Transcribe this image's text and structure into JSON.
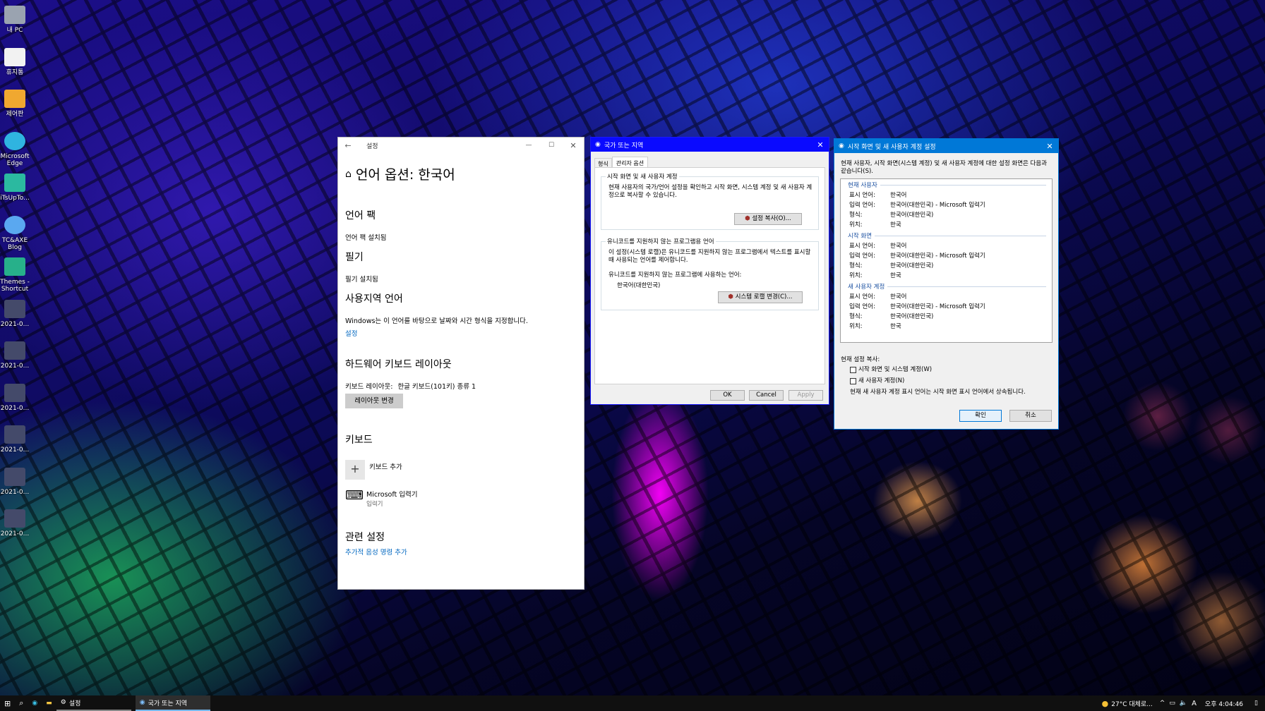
{
  "desktop": {
    "icons": [
      {
        "label": "내 PC",
        "icon": "computer-icon"
      },
      {
        "label": "휴지통",
        "icon": "recycle-bin-icon"
      },
      {
        "label": "제어판",
        "icon": "control-panel-icon"
      },
      {
        "label": "Microsoft Edge",
        "icon": "edge-icon"
      },
      {
        "label": "iTsUpTo...",
        "icon": "app-icon"
      },
      {
        "label": "TC&AXE Blog",
        "icon": "cloud-icon"
      },
      {
        "label": "Themes - Shortcut",
        "icon": "themes-icon"
      },
      {
        "label": "2021-0...",
        "icon": "image-file-icon"
      },
      {
        "label": "2021-0...",
        "icon": "image-file-icon"
      },
      {
        "label": "2021-0...",
        "icon": "image-file-icon"
      },
      {
        "label": "2021-0...",
        "icon": "image-file-icon"
      },
      {
        "label": "2021-0...",
        "icon": "image-file-icon"
      },
      {
        "label": "2021-0...",
        "icon": "image-file-icon"
      }
    ]
  },
  "settings": {
    "title": "설정",
    "page_title": "언어 옵션: 한국어",
    "lang_pack_heading": "언어 팩",
    "lang_pack_status": "언어 팩 설치됨",
    "handwriting_heading": "필기",
    "handwriting_status": "필기 설치됨",
    "regional_heading": "사용지역 언어",
    "regional_desc": "Windows는 이 언어를 바탕으로 날짜와 시간 형식을 지정합니다.",
    "regional_link": "설정",
    "hw_kb_heading": "하드웨어 키보드 레이아웃",
    "hw_kb_label": "키보드 레이아웃:",
    "hw_kb_value": "한글 키보드(101키) 종류 1",
    "hw_kb_button": "레이아웃 변경",
    "keyboards_heading": "키보드",
    "add_keyboard": "키보드 추가",
    "ime_name": "Microsoft 입력기",
    "ime_sub": "입력기",
    "related_heading": "관련 설정",
    "related_link": "추가적 음성 명령 추가"
  },
  "region": {
    "title": "국가 또는 지역",
    "tabs": [
      "형식",
      "관리자 옵션"
    ],
    "group1_title": "시작 화면 및 새 사용자 계정",
    "group1_desc": "현재 사용자의 국가/언어 설정을 확인하고 시작 화면, 시스템 계정 및 새 사용자 계정으로 복사할 수 있습니다.",
    "copy_button": "설정 복사(O)...",
    "group2_title": "유니코드를 지원하지 않는 프로그램용 언어",
    "group2_desc": "이 설정(시스템 로캘)은 유니코드를 지원하지 않는 프로그램에서 텍스트를 표시할 때 사용되는 언어를 제어합니다.",
    "current_label": "유니코드를 지원하지 않는 프로그램에 사용하는 언어:",
    "current_value": "한국어(대한민국)",
    "change_locale_button": "시스템 로캘 변경(C)...",
    "ok": "OK",
    "cancel": "Cancel",
    "apply": "Apply"
  },
  "copy_dialog": {
    "title": "시작 화면 및 새 사용자 계정 설정",
    "intro": "현재 사용자, 시작 화면(시스템 계정) 및 새 사용자 계정에 대한 설정 화면은 다음과 같습니다(S).",
    "sections": [
      {
        "name": "현재 사용자",
        "rows": [
          [
            "표시 언어:",
            "한국어"
          ],
          [
            "입력 언어:",
            "한국어(대한민국) - Microsoft 입력기"
          ],
          [
            "형식:",
            "한국어(대한민국)"
          ],
          [
            "위치:",
            "한국"
          ]
        ]
      },
      {
        "name": "시작 화면",
        "rows": [
          [
            "표시 언어:",
            "한국어"
          ],
          [
            "입력 언어:",
            "한국어(대한민국) - Microsoft 입력기"
          ],
          [
            "형식:",
            "한국어(대한민국)"
          ],
          [
            "위치:",
            "한국"
          ]
        ]
      },
      {
        "name": "새 사용자 계정",
        "rows": [
          [
            "표시 언어:",
            "한국어"
          ],
          [
            "입력 언어:",
            "한국어(대한민국) - Microsoft 입력기"
          ],
          [
            "형식:",
            "한국어(대한민국)"
          ],
          [
            "위치:",
            "한국"
          ]
        ]
      }
    ],
    "copy_label": "현재 설정 복사:",
    "check1": "시작 화면 및 시스템 계정(W)",
    "check2": "새 사용자 계정(N)",
    "note": "현재 새 사용자 계정 표시 언어는 시작 화면 표시 언어에서 상속됩니다.",
    "ok": "확인",
    "cancel": "취소"
  },
  "taskbar": {
    "apps": [
      {
        "label": "설정",
        "icon": "gear-icon"
      },
      {
        "label": "국가 또는 지역",
        "icon": "globe-icon"
      }
    ],
    "weather": "27°C 대체로...",
    "ime": "A",
    "clock": "오후 4:04:46"
  }
}
